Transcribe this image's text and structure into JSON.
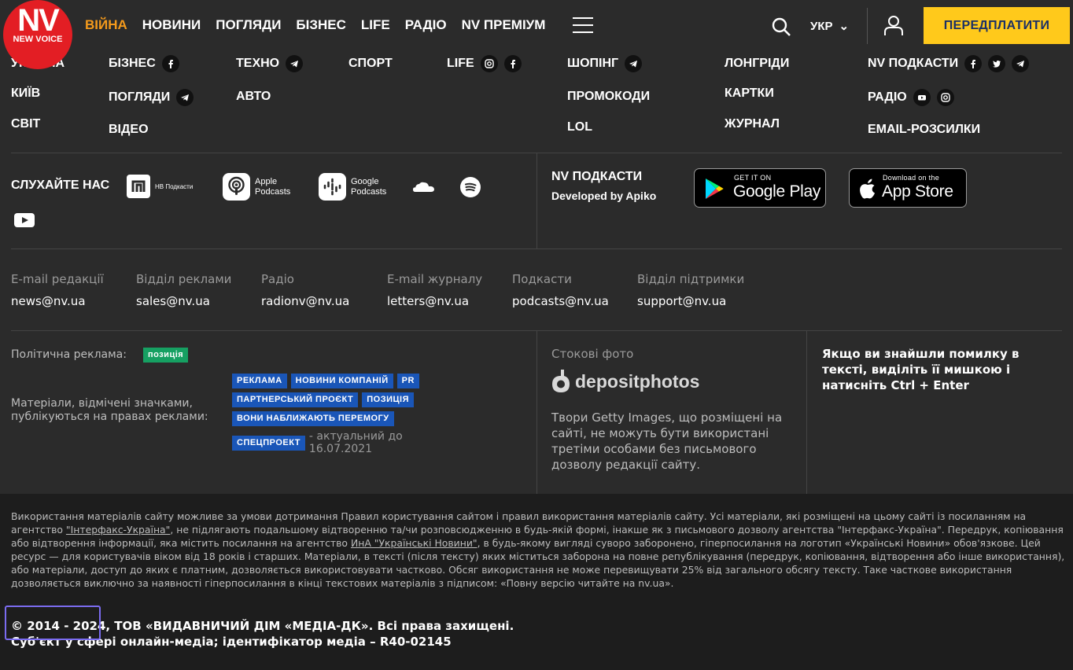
{
  "logo": {
    "main": "NV",
    "sub": "NEW VOICE"
  },
  "nav": [
    {
      "label": "ВІЙНА"
    },
    {
      "label": "НОВИНИ"
    },
    {
      "label": "ПОГЛЯДИ"
    },
    {
      "label": "БІЗНЕС"
    },
    {
      "label": "LIFE"
    },
    {
      "label": "РАДІО"
    },
    {
      "label": "NV ПРЕМІУМ"
    }
  ],
  "header": {
    "lang": "УКР",
    "subscribe": "ПЕРЕДПЛАТИТИ"
  },
  "menu": {
    "ukraine": "УКРАЇНА",
    "kyiv": "КИЇВ",
    "world": "СВІТ",
    "business": "БІЗНЕС",
    "opinions": "ПОГЛЯДИ",
    "video": "ВІДЕО",
    "techno": "ТЕХНО",
    "auto": "АВТО",
    "sport": "СПОРТ",
    "life": "LIFE",
    "shopping": "ШОПІНГ",
    "promocodes": "ПРОМОКОДИ",
    "lol": "LOL",
    "longreads": "ЛОНГРІДИ",
    "cards": "КАРТКИ",
    "magazine": "ЖУРНАЛ",
    "podcasts": "NV ПОДКАСТИ",
    "radio": "РАДІО",
    "newsletters": "EMAIL-РОЗСИЛКИ"
  },
  "listen": {
    "title": "СЛУХАЙТЕ НАС",
    "nv_podcasts_badge": "НВ Подкасти",
    "apple_line1": "Apple",
    "apple_line2": "Podcasts",
    "google_line1": "Google",
    "google_line2": "Podcasts"
  },
  "app": {
    "title": "NV ПОДКАСТИ",
    "developer": "Developed by Apiko",
    "google_small": "GET IT ON",
    "google_big": "Google Play",
    "apple_small": "Download on the",
    "apple_big": "App Store"
  },
  "contacts": [
    {
      "label": "E-mail редакції",
      "value": "news@nv.ua"
    },
    {
      "label": "Відділ реклами",
      "value": "sales@nv.ua"
    },
    {
      "label": "Радіо",
      "value": "radionv@nv.ua"
    },
    {
      "label": "E-mail журналу",
      "value": "letters@nv.ua"
    },
    {
      "label": "Подкасти",
      "value": "podcasts@nv.ua"
    },
    {
      "label": "Відділ підтримки",
      "value": "support@nv.ua"
    }
  ],
  "ads": {
    "political_label": "Політична реклама:",
    "political_tag": "позиція",
    "materials_note": "Матеріали, відмічені значками, публікуються на правах реклами:",
    "tags": [
      "РЕКЛАМА",
      "НОВИНИ КОМПАНІЙ",
      "PR",
      "ПАРТНЕРСЬКИЙ ПРОЄКТ",
      "ПОЗИЦІЯ",
      "ВОНИ НАБЛИЖАЮТЬ ПЕРЕМОГУ",
      "СПЕЦПРОЕКТ"
    ],
    "special_note": "- актуальний до 16.07.2021"
  },
  "stock": {
    "title": "Стокові фото",
    "brand": "depositphotos",
    "note": "Твори Getty Images, що розміщені на сайті, не можуть бути використані третіми особами без письмового дозволу редакції сайту."
  },
  "error_note": "Якщо ви знайшли помилку в тексті, виділіть її мишкою і натисніть Ctrl + Enter",
  "legal": {
    "p1": "Використання матеріалів сайту можливе за умови дотримання Правил користування сайтом і правил використання матеріалів сайту. Усі матеріали, які розміщені на цьому сайті із посиланням на агентство ",
    "link1": "\"Інтерфакс-Україна\"",
    "p2": ", не підлягають подальшому відтворенню та/чи розповсюдженню в будь-якій формі, інакше як з письмового дозволу агентства \"Інтерфакс-Україна\". Передрук, копіювання або відтворення інформації, яка містить посилання на агентство ",
    "link2": "ИнА \"Українські Новини\"",
    "p3": ", в будь-якому вигляді суворо заборонено, гіперпосилання на логотип «Українські Новини» обов'язкове. Цей ресурс — для користувачів віком від 18 років і старших. Матеріали, в тексті (після тексту) яких міститься заборона на повне републікування (передрук, копіювання, відтворення або інше використання), або матеріали, доступ до яких є платним, дозволяється використовувати частково. Обсяг використання не може перевищувати 25% від загального обсягу тексту. Таке часткове використання дозволяється виключно за наявності гіперпосилання в кінці текстових матеріалів з підписом: «Повну версію читайте на nv.ua»."
  },
  "copyright": {
    "line1": "© 2014 - 2024, ТОВ «ВИДАВНИЧИЙ ДІМ «МЕДІА-ДК». Всі права захищені.",
    "line2": "Суб'єкт у сфері онлайн-медіа; ідентифікатор медіа – R40-02145"
  }
}
